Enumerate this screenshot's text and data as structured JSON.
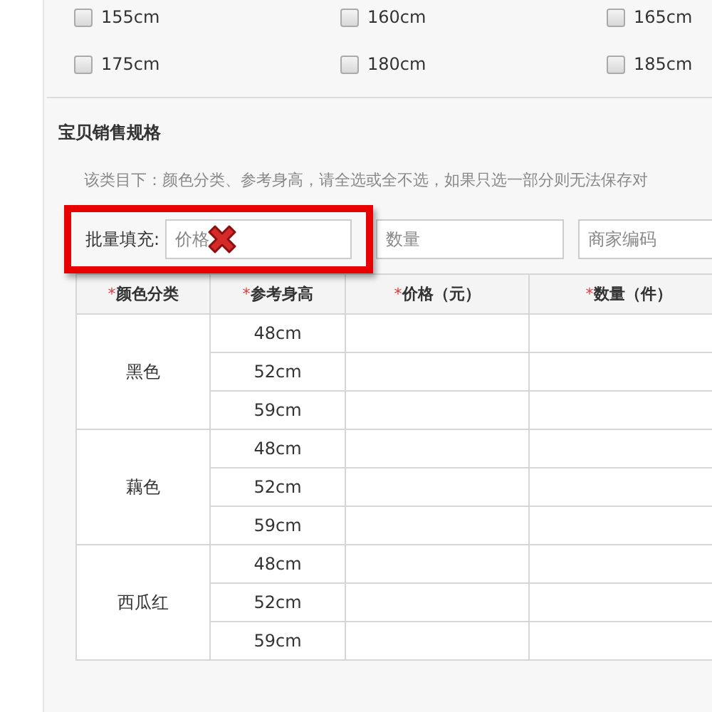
{
  "sizes": [
    {
      "label": "155cm",
      "checked": false
    },
    {
      "label": "160cm",
      "checked": false
    },
    {
      "label": "165cm",
      "checked": false
    },
    {
      "label": "175cm",
      "checked": false
    },
    {
      "label": "180cm",
      "checked": false
    },
    {
      "label": "185cm",
      "checked": false
    }
  ],
  "section_title": "宝贝销售规格",
  "notice_lines": [
    "该类目下：颜色分类、参考身高，请全选或全不选，如果只选一部分则无法保存对"
  ],
  "batch_fill": {
    "label": "批量填充:",
    "highlighted": true,
    "fields": [
      {
        "placeholder": "价格"
      },
      {
        "placeholder": "数量"
      },
      {
        "placeholder": "商家编码"
      }
    ]
  },
  "table": {
    "columns": [
      {
        "mark": "*",
        "label": "颜色分类"
      },
      {
        "mark": "*",
        "label": "参考身高"
      },
      {
        "mark": "*",
        "label": "价格（元）"
      },
      {
        "mark": "*",
        "label": "数量（件）"
      }
    ],
    "groups": [
      {
        "name": "黑色",
        "heights": [
          "48cm",
          "52cm",
          "59cm"
        ]
      },
      {
        "name": "藕色",
        "heights": [
          "48cm",
          "52cm",
          "59cm"
        ]
      },
      {
        "name": "西瓜红",
        "heights": [
          "48cm",
          "52cm",
          "59cm"
        ]
      }
    ]
  }
}
